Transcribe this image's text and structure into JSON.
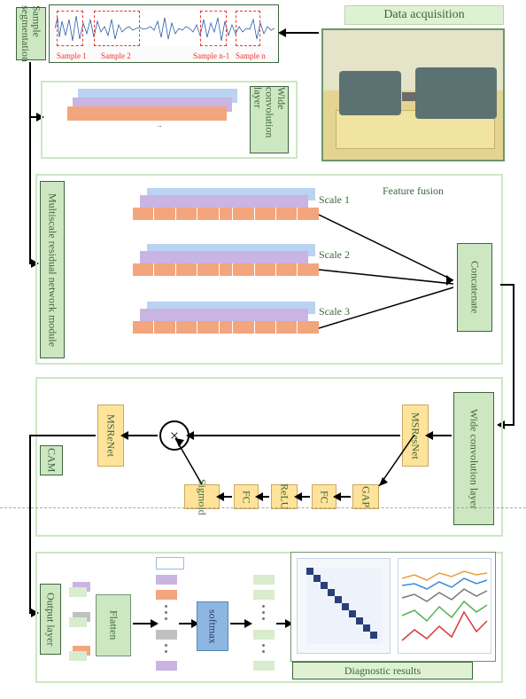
{
  "domain": "Diagram",
  "data_acquisition": {
    "title": "Data acquisition"
  },
  "sample_segmentation": {
    "label": "Sample segmentation",
    "samples": [
      "Sample 1",
      "Sample 2",
      "Sample n-1",
      "Sample n"
    ]
  },
  "wide_conv_1": {
    "label": "Wide convolution layer"
  },
  "multiscale": {
    "label": "Multiscale residual network module",
    "feature_fusion": "Feature fusion",
    "concatenate": "Concatenate",
    "scales": [
      "Scale 1",
      "Scale 2",
      "Scale 3"
    ]
  },
  "cam": {
    "label": "CAM",
    "wide_conv": "Wide convolution layer",
    "blocks": {
      "msresnet_right": "MSResNet",
      "gap": "GAP",
      "fc1": "FC",
      "relu": "ReLU",
      "fc2": "FC",
      "sigmoid": "Sigmoid",
      "msresnet_left": "MSReNet"
    },
    "mult": "×"
  },
  "output": {
    "label": "Output layer",
    "flatten": "Flatten",
    "softmax": "softmax",
    "diagnostic": "Diagnostic results"
  },
  "colors": {
    "green": "#cde7c2",
    "green_b": "#6e956e",
    "orange": "#f3a57d",
    "purple": "#c9b4e3",
    "blue": "#b9d3f1",
    "yellow": "#ffe39a",
    "wave": "#2a5da8",
    "red": "#e33b3b"
  }
}
